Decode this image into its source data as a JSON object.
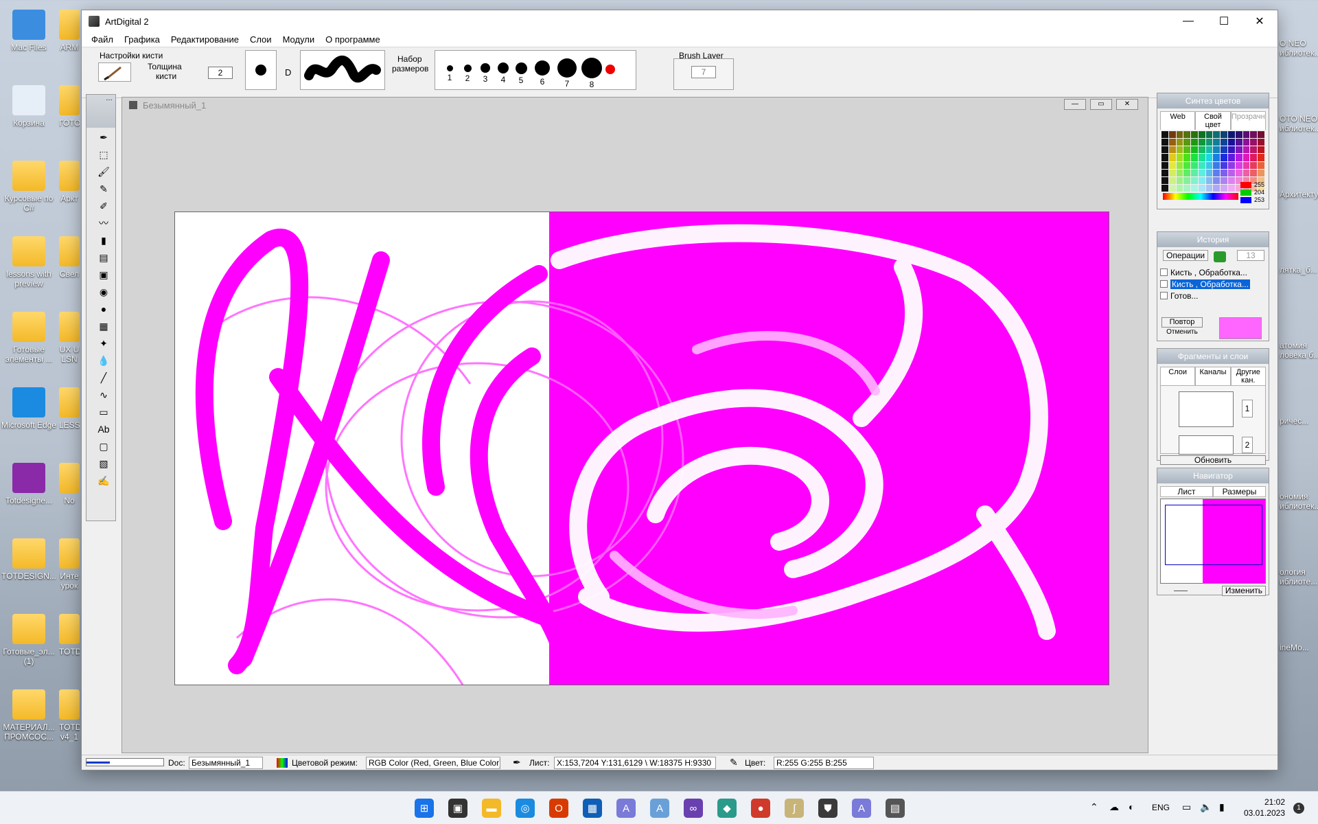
{
  "desktop": {
    "left_icons": [
      {
        "label": "Mac Files",
        "color": "#3b8de0"
      },
      {
        "label": "Корзина",
        "color": "#e6eef7"
      },
      {
        "label": "Курсовые по C#",
        "color": "folder"
      },
      {
        "label": "lessons with preview",
        "color": "folder"
      },
      {
        "label": "Готовые элементы ...",
        "color": "folder"
      },
      {
        "label": "Microsoft Edge",
        "color": "#1a8be0"
      },
      {
        "label": "Totdesigne...",
        "color": "#8a2aa8"
      },
      {
        "label": "TOTDESIGN...",
        "color": "folder"
      },
      {
        "label": "Готовые_эл... (1)",
        "color": "folder"
      },
      {
        "label": "МАТЕРИАЛ... ПРОМСОС...",
        "color": "folder"
      }
    ],
    "second_col": [
      "ARM",
      "ГОТО",
      "Аркт",
      "Свел",
      "UX U LSN",
      "LESS",
      "No",
      "Инте урок",
      "TOTD",
      "TOTD v4_1"
    ],
    "right_icons": [
      "O NEO иблиотек...",
      "OTO NEO иблиотек...",
      "Архитектура",
      "лятка_б...",
      "атомия ловека б...",
      "ричес...",
      "ономия иблиотек...",
      "ология иблиоте...",
      "inеМо..."
    ]
  },
  "window": {
    "title": "ArtDigital 2",
    "controls": {
      "minimize": "—",
      "maximize": "☐",
      "close": "✕"
    },
    "menu": [
      "Файл",
      "Графика",
      "Редактирование",
      "Слои",
      "Модули",
      "О программе"
    ]
  },
  "brushbar": {
    "settings_label": "Настройки кисти",
    "thickness_label_1": "Толщина",
    "thickness_label_2": "кисти",
    "thickness_value": "2",
    "d_label": "D",
    "sizes_label_1": "Набор",
    "sizes_label_2": "размеров",
    "sizes": [
      {
        "n": "1",
        "size": 9
      },
      {
        "n": "2",
        "size": 11
      },
      {
        "n": "3",
        "size": 14
      },
      {
        "n": "4",
        "size": 16
      },
      {
        "n": "5",
        "size": 17
      },
      {
        "n": "6",
        "size": 22
      },
      {
        "n": "7",
        "size": 28
      },
      {
        "n": "8",
        "size": 30
      }
    ],
    "brush_layer_label": "Brush Layer",
    "brush_layer_value": "7"
  },
  "document": {
    "title": "Безымянный_1"
  },
  "panels": {
    "color_synth": {
      "title": "Синтез цветов",
      "tabs": [
        "Web",
        "Свой цвет",
        "Прозрачн"
      ],
      "values": [
        "255",
        "204",
        "253"
      ]
    },
    "history": {
      "title": "История",
      "operations_label": "Операции",
      "count": "13",
      "items": [
        "Кисть , Обработка...",
        "Кисть , Обработка...",
        "Готов..."
      ],
      "selected_index": 1,
      "repeat_label": "Повтор",
      "undo_label": "Отменить"
    },
    "fragments": {
      "title": "Фрагменты и слои",
      "tabs": [
        "Слои",
        "Каналы",
        "Другие кан."
      ],
      "layers": [
        "1",
        "2"
      ],
      "refresh_label": "Обновить"
    },
    "navigator": {
      "title": "Навигатор",
      "tabs": [
        "Лист",
        "Размеры"
      ],
      "change_label": "Изменить"
    }
  },
  "status": {
    "doc_label": "Doc:",
    "doc_value": "Безымянный_1",
    "mode_label": "Цветовой режим:",
    "mode_value": "RGB Color (Red, Green, Blue Color)",
    "sheet_label": "Лист:",
    "sheet_value": "X:153,7204 Y:131,6129 \\ W:18375 H:9330",
    "color_label": "Цвет:",
    "color_value": "R:255 G:255 B:255"
  },
  "taskbar": {
    "lang": "ENG",
    "time": "21:02",
    "date": "03.01.2023",
    "notif": "1"
  },
  "colors": {
    "magenta": "#ff00ff",
    "accent": "#0a64d6"
  }
}
